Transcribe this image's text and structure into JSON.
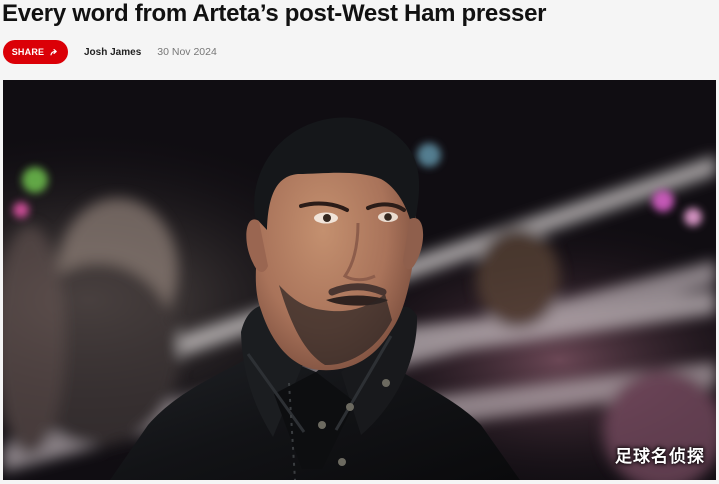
{
  "article": {
    "title": "Every word from Arteta’s post-West Ham presser",
    "share_label": "SHARE",
    "share_icon": "share-arrow-icon",
    "author": "Josh James",
    "date": "30 Nov 2024",
    "accent_color": "#db0007"
  },
  "hero_image": {
    "subject": "man-in-black-coat-portrait",
    "watermark": "足球名侦探"
  }
}
